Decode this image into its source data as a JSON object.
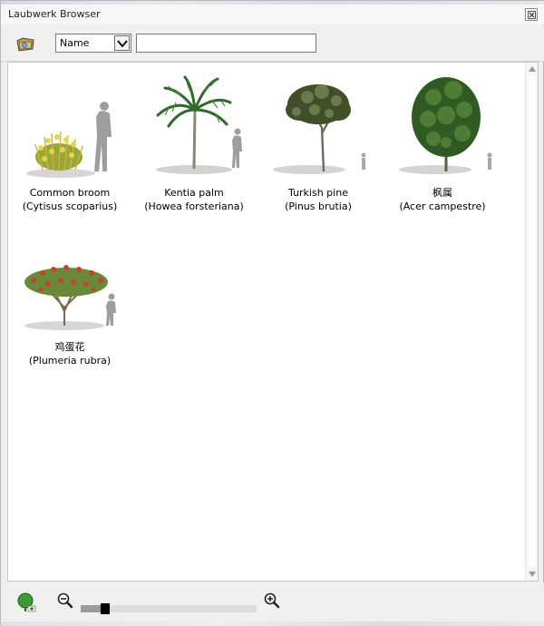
{
  "window": {
    "title": "Laubwerk Browser"
  },
  "toolbar": {
    "open_icon": "open-folder-icon",
    "sort_value": "Name",
    "search_value": "",
    "search_placeholder": ""
  },
  "plants": [
    {
      "name": "Common broom",
      "latin": "(Cytisus scoparius)",
      "thumb": "broom-thumbnail"
    },
    {
      "name": "Kentia palm",
      "latin": "(Howea forsteriana)",
      "thumb": "palm-thumbnail"
    },
    {
      "name": "Turkish pine",
      "latin": "(Pinus brutia)",
      "thumb": "pine-thumbnail"
    },
    {
      "name": "枫属",
      "latin": "(Acer campestre)",
      "thumb": "maple-thumbnail"
    },
    {
      "name": "鸡蛋花",
      "latin": "(Plumeria rubra)",
      "thumb": "plumeria-thumbnail"
    }
  ],
  "statusbar": {
    "add_icon": "add-plant-icon",
    "zoom_out_icon": "zoom-out-icon",
    "zoom_in_icon": "zoom-in-icon",
    "zoom_fraction": 0.14
  },
  "colors": {
    "window_bg": "#f0f0f0",
    "content_bg": "#ffffff"
  }
}
